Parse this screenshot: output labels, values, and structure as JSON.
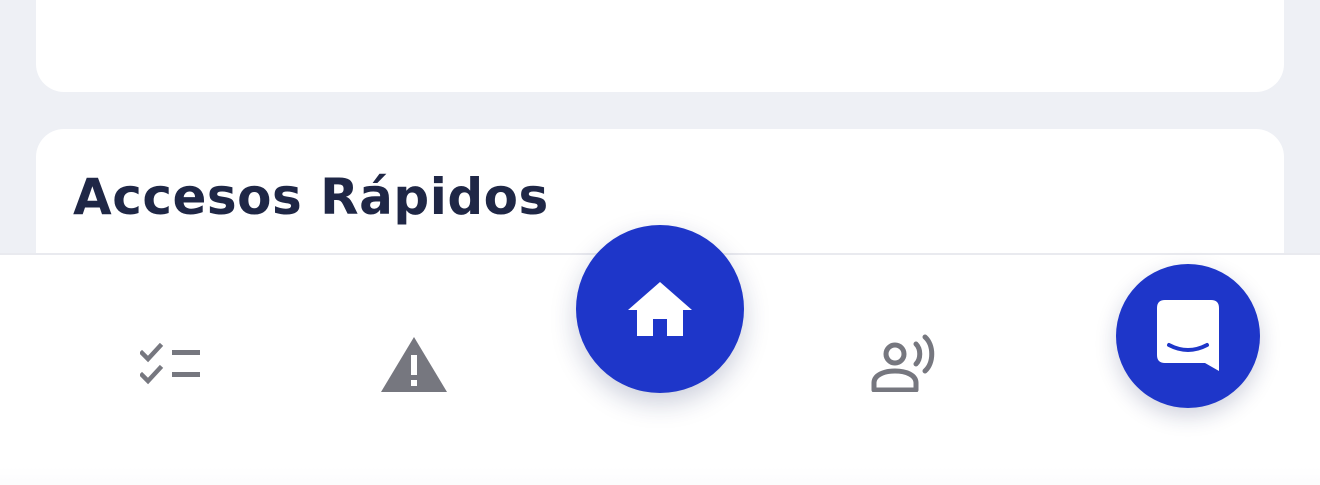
{
  "quick_access": {
    "title": "Accesos Rápidos"
  },
  "bottom_nav": {
    "items": [
      {
        "icon": "checklist-icon"
      },
      {
        "icon": "warning-icon"
      },
      {
        "icon": "home-icon",
        "active": true
      },
      {
        "icon": "record-voice-icon"
      }
    ]
  },
  "chat_widget": {
    "icon": "chat-smile-icon"
  },
  "colors": {
    "accent": "#1e36c9",
    "title_text": "#1f2746",
    "nav_icon": "#76777f",
    "background": "#eef0f5",
    "card": "#ffffff"
  }
}
